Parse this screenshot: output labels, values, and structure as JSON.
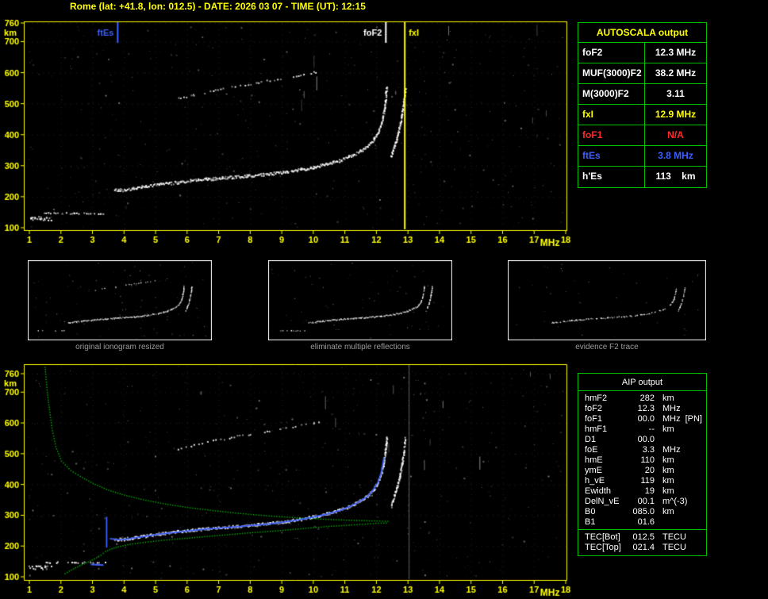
{
  "header": {
    "title": "Rome (lat: +41.8, lon: 012.5) - DATE: 2026 03 07 - TIME (UT): 12:15"
  },
  "colors": {
    "yellow": "#ffff00",
    "table_green": "#00c000",
    "blue": "#3e5fff",
    "red": "#ff2a2a",
    "white": "#ffffff",
    "caption_gray": "#9a9a9a",
    "profile_green": "#00b400",
    "marker_gray": "#787878"
  },
  "autoscala_table": {
    "title": "AUTOSCALA output",
    "rows": [
      {
        "label": "foF2",
        "value": "12.3 MHz",
        "color": "#ffffff"
      },
      {
        "label": "MUF(3000)F2",
        "value": "38.2 MHz",
        "color": "#ffffff"
      },
      {
        "label": "M(3000)F2",
        "value": "3.11",
        "color": "#ffffff"
      },
      {
        "label": "fxI",
        "value": "12.9 MHz",
        "color": "#ffff00"
      },
      {
        "label": "foF1",
        "value": "N/A",
        "color": "#ff2a2a"
      },
      {
        "label": "ftEs",
        "value": "3.8 MHz",
        "color": "#3e5fff"
      },
      {
        "label": "h'Es",
        "value": "113    km",
        "color": "#ffffff"
      }
    ]
  },
  "thumbnails": [
    {
      "caption": "original ionogram resized"
    },
    {
      "caption": "eliminate multiple reflections"
    },
    {
      "caption": "evidence F2 trace"
    }
  ],
  "aip_table": {
    "title": "AIP output",
    "rows": [
      {
        "label": "hmF2",
        "value": "282",
        "unit": "km",
        "note": ""
      },
      {
        "label": "foF2",
        "value": "12.3",
        "unit": "MHz",
        "note": ""
      },
      {
        "label": "foF1",
        "value": "00.0",
        "unit": "MHz",
        "note": "[PN]"
      },
      {
        "label": "hmF1",
        "value": "--",
        "unit": "km",
        "note": ""
      },
      {
        "label": "D1",
        "value": "00.0",
        "unit": "",
        "note": ""
      },
      {
        "label": "foE",
        "value": "3.3",
        "unit": "MHz",
        "note": ""
      },
      {
        "label": "hmE",
        "value": "110",
        "unit": "km",
        "note": ""
      },
      {
        "label": "ymE",
        "value": "20",
        "unit": "km",
        "note": ""
      },
      {
        "label": "h_vE",
        "value": "119",
        "unit": "km",
        "note": ""
      },
      {
        "label": "Ewidth",
        "value": "19",
        "unit": "km",
        "note": ""
      },
      {
        "label": "DelN_vE",
        "value": "00.1",
        "unit": "m^(-3)",
        "note": ""
      },
      {
        "label": "B0",
        "value": "085.0",
        "unit": "km",
        "note": ""
      },
      {
        "label": "B1",
        "value": "01.6",
        "unit": "",
        "note": ""
      }
    ],
    "tec_rows": [
      {
        "label": "TEC[Bot]",
        "value": "012.5",
        "unit": "TECU"
      },
      {
        "label": "TEC[Top]",
        "value": "021.4",
        "unit": "TECU"
      }
    ]
  },
  "chart_data": {
    "type": "scatter",
    "title": "Ionogram - Rome 2026 03 07 12:15 UT",
    "x_axis": {
      "label": "MHz",
      "range": [
        1,
        18
      ],
      "ticks": [
        1,
        2,
        3,
        4,
        5,
        6,
        7,
        8,
        9,
        10,
        11,
        12,
        13,
        14,
        15,
        16,
        17,
        18
      ]
    },
    "y_axis": {
      "label": "km",
      "range": [
        100,
        760
      ],
      "ticks": [
        760,
        700,
        600,
        500,
        400,
        300,
        200,
        100
      ]
    },
    "scaled_values": {
      "foF2_MHz": 12.3,
      "fxI_MHz": 12.9,
      "ftEs_MHz": 3.8,
      "hEs_km": 113,
      "MUF3000F2_MHz": 38.2,
      "M3000F2": 3.11,
      "hmF2_km": 282,
      "foE_MHz": 3.3,
      "hmE_km": 110
    },
    "top_plot": {
      "markers": [
        {
          "name": "ftEs",
          "freq": 3.8,
          "color": "#3e5fff",
          "full_height": false,
          "label_side": "left"
        },
        {
          "name": "foF2",
          "freq": 12.3,
          "color": "#ffffff",
          "full_height": false,
          "label_side": "left"
        },
        {
          "name": "fxI",
          "freq": 12.9,
          "color": "#ffff00",
          "full_height": true,
          "label_side": "right"
        }
      ],
      "traces": [
        "es_low",
        "es_main",
        "f2",
        "x_branch",
        "multiple"
      ]
    },
    "bottom_plot": {
      "markers": [
        {
          "name": "",
          "freq": 13.05,
          "color": "#787878",
          "full_height": true,
          "label_side": "none"
        }
      ],
      "traces": [
        "es_low",
        "es_main",
        "f2",
        "x_branch",
        "multiple"
      ],
      "blue_trace": [
        [
          [
            3.45,
            195
          ],
          [
            3.45,
            295
          ]
        ],
        [
          [
            2.95,
            140
          ],
          [
            3.35,
            138
          ]
        ],
        [
          [
            3.55,
            224
          ],
          [
            3.8,
            220
          ],
          [
            4.0,
            221
          ],
          [
            4.3,
            226
          ],
          [
            4.7,
            232
          ],
          [
            5.1,
            238
          ],
          [
            5.6,
            244
          ],
          [
            6.1,
            250
          ],
          [
            6.6,
            255
          ],
          [
            7.1,
            259
          ],
          [
            7.6,
            263
          ],
          [
            8.1,
            267
          ],
          [
            8.6,
            272
          ],
          [
            9.1,
            278
          ],
          [
            9.6,
            286
          ],
          [
            10.0,
            294
          ],
          [
            10.4,
            303
          ],
          [
            10.8,
            314
          ],
          [
            11.1,
            326
          ],
          [
            11.4,
            341
          ],
          [
            11.7,
            360
          ],
          [
            11.9,
            382
          ],
          [
            12.05,
            407
          ],
          [
            12.15,
            437
          ],
          [
            12.2,
            464
          ],
          [
            12.24,
            488
          ]
        ]
      ],
      "green_profile": [
        [
          1.48,
          790
        ],
        [
          1.5,
          760
        ],
        [
          1.55,
          700
        ],
        [
          1.62,
          645
        ],
        [
          1.7,
          585
        ],
        [
          1.82,
          525
        ],
        [
          2.0,
          478
        ],
        [
          2.3,
          447
        ],
        [
          2.6,
          428
        ],
        [
          3.0,
          405
        ],
        [
          3.5,
          383
        ],
        [
          4.0,
          367
        ],
        [
          4.6,
          352
        ],
        [
          5.3,
          338
        ],
        [
          6.0,
          327
        ],
        [
          6.8,
          317
        ],
        [
          7.6,
          308
        ],
        [
          8.5,
          300
        ],
        [
          9.4,
          294
        ],
        [
          10.3,
          289
        ],
        [
          11.2,
          285
        ],
        [
          12.0,
          283
        ],
        [
          12.35,
          282
        ],
        [
          12.3,
          277
        ],
        [
          11.8,
          274
        ],
        [
          11.2,
          270
        ],
        [
          10.4,
          265
        ],
        [
          9.5,
          257
        ],
        [
          8.7,
          250
        ],
        [
          7.9,
          244
        ],
        [
          7.1,
          237
        ],
        [
          6.3,
          230
        ],
        [
          5.6,
          224
        ],
        [
          5.0,
          218
        ],
        [
          4.5,
          212
        ],
        [
          4.1,
          206
        ],
        [
          3.8,
          199
        ],
        [
          3.6,
          193
        ],
        [
          3.4,
          184
        ],
        [
          3.25,
          172
        ],
        [
          3.05,
          160
        ],
        [
          2.85,
          150
        ],
        [
          2.65,
          141
        ],
        [
          2.45,
          131
        ],
        [
          2.25,
          120
        ],
        [
          2.05,
          108
        ]
      ]
    },
    "traces": {
      "es_low": {
        "style": "blob",
        "color": "#ffffff",
        "points": [
          [
            1.0,
            131
          ],
          [
            1.35,
            133
          ],
          [
            1.63,
            130
          ]
        ]
      },
      "es_main": {
        "style": "dash",
        "color": "#ffffff",
        "points": [
          [
            1.45,
            149
          ],
          [
            2.4,
            148
          ],
          [
            3.38,
            148
          ]
        ]
      },
      "f2": {
        "style": "band",
        "color": "#ffffff",
        "points": [
          [
            3.68,
            226
          ],
          [
            3.8,
            223
          ],
          [
            4.0,
            224
          ],
          [
            4.3,
            229
          ],
          [
            4.7,
            235
          ],
          [
            5.1,
            241
          ],
          [
            5.6,
            247
          ],
          [
            6.1,
            253
          ],
          [
            6.6,
            258
          ],
          [
            7.1,
            262
          ],
          [
            7.6,
            266
          ],
          [
            8.1,
            270
          ],
          [
            8.6,
            275
          ],
          [
            9.1,
            281
          ],
          [
            9.6,
            289
          ],
          [
            10.0,
            297
          ],
          [
            10.4,
            306
          ],
          [
            10.8,
            317
          ],
          [
            11.1,
            329
          ],
          [
            11.4,
            344
          ],
          [
            11.7,
            363
          ],
          [
            11.9,
            385
          ],
          [
            12.05,
            410
          ],
          [
            12.15,
            440
          ],
          [
            12.22,
            475
          ],
          [
            12.27,
            510
          ],
          [
            12.3,
            540
          ],
          [
            12.31,
            556
          ]
        ]
      },
      "x_branch": {
        "style": "band",
        "color": "#ffffff",
        "points": [
          [
            12.45,
            330
          ],
          [
            12.55,
            362
          ],
          [
            12.65,
            396
          ],
          [
            12.73,
            432
          ],
          [
            12.8,
            470
          ],
          [
            12.85,
            506
          ],
          [
            12.88,
            535
          ],
          [
            12.9,
            552
          ]
        ]
      },
      "multiple": {
        "style": "sparse",
        "color": "#ffffff",
        "points": [
          [
            5.7,
            518
          ],
          [
            6.2,
            530
          ],
          [
            6.8,
            543
          ],
          [
            7.4,
            555
          ],
          [
            8.0,
            566
          ],
          [
            8.6,
            576
          ],
          [
            9.1,
            585
          ],
          [
            9.6,
            594
          ],
          [
            10.0,
            602
          ],
          [
            10.15,
            606
          ]
        ]
      }
    },
    "thumb_range": [
      1,
      14
    ],
    "thumbs": [
      {
        "traces": [
          "es_main",
          "f2",
          "x_branch",
          "multiple"
        ],
        "noise": 90,
        "dim": false
      },
      {
        "traces": [
          "es_main",
          "f2",
          "x_branch"
        ],
        "noise": 60,
        "dim": false
      },
      {
        "traces": [
          "f2",
          "x_branch"
        ],
        "noise": 40,
        "dim": true
      }
    ]
  }
}
